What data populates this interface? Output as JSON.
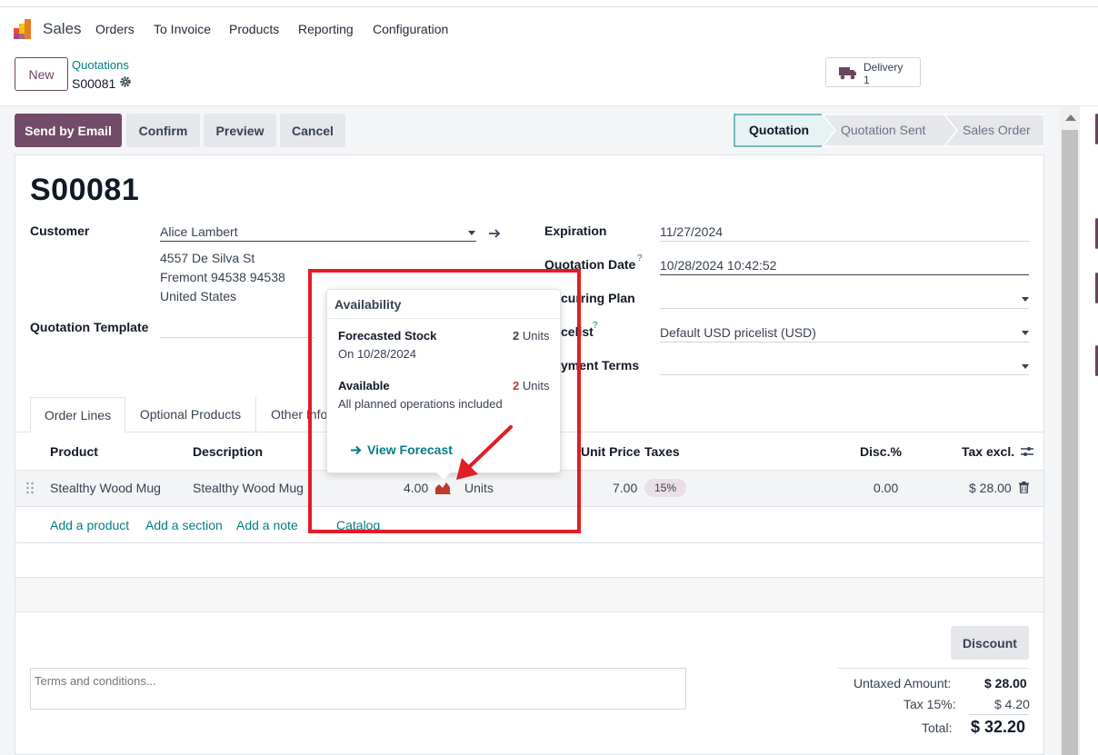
{
  "navbar": {
    "app_name": "Sales",
    "menu": [
      "Orders",
      "To Invoice",
      "Products",
      "Reporting",
      "Configuration"
    ]
  },
  "control_panel": {
    "new_label": "New",
    "breadcrumb_parent": "Quotations",
    "breadcrumb_current": "S00081",
    "smart_button": {
      "label": "Delivery",
      "count": "1"
    }
  },
  "actions": {
    "send_email": "Send by Email",
    "confirm": "Confirm",
    "preview": "Preview",
    "cancel": "Cancel"
  },
  "status_bar": {
    "stages": [
      "Quotation",
      "Quotation Sent",
      "Sales Order"
    ],
    "active": "Quotation"
  },
  "form": {
    "title": "S00081",
    "customer_label": "Customer",
    "customer_value": "Alice Lambert",
    "address_line1": "4557 De Silva St",
    "address_line2": "Fremont 94538 94538",
    "address_line3": "United States",
    "template_label": "Quotation Template",
    "expiration_label": "Expiration",
    "expiration_value": "11/27/2024",
    "quotation_date_label": "Quotation Date",
    "quotation_date_value": "10/28/2024 10:42:52",
    "recurring_label_visible": "curring Plan",
    "pricelist_label_visible": "celist",
    "pricelist_value": "Default USD pricelist (USD)",
    "payment_terms_label_visible": "yment Terms",
    "help_mark": "?"
  },
  "tabs": [
    "Order Lines",
    "Optional Products",
    "Other Info"
  ],
  "tabs_visible_other": "Other Info",
  "table": {
    "headers": {
      "product": "Product",
      "description": "Description",
      "unit_price": "Unit Price",
      "taxes": "Taxes",
      "discount": "Disc.%",
      "tax_excl": "Tax excl."
    },
    "rows": [
      {
        "product": "Stealthy Wood Mug",
        "description": "Stealthy Wood Mug",
        "quantity": "4.00",
        "uom": "Units",
        "unit_price": "7.00",
        "tax": "15%",
        "discount": "0.00",
        "subtotal": "$ 28.00"
      }
    ],
    "add_links": [
      "Add a product",
      "Add a section",
      "Add a note",
      "Catalog"
    ]
  },
  "popover": {
    "title": "Availability",
    "forecast_title": "Forecasted Stock",
    "forecast_qty": "2",
    "forecast_unit": "Units",
    "forecast_date": "On 10/28/2024",
    "available_title": "Available",
    "available_qty": "2",
    "available_unit": "Units",
    "available_note": "All planned operations included",
    "link": "View Forecast"
  },
  "footer": {
    "discount_btn": "Discount",
    "terms_placeholder": "Terms and conditions...",
    "untaxed_label": "Untaxed Amount:",
    "untaxed_value": "$ 28.00",
    "tax_label": "Tax 15%:",
    "tax_value": "$ 4.20",
    "total_label": "Total:",
    "total_value": "$ 32.20"
  },
  "colors": {
    "brand": "#714b67",
    "link": "#017e84",
    "annotation": "#e11d26",
    "forecast_icon": "#c0392b"
  }
}
